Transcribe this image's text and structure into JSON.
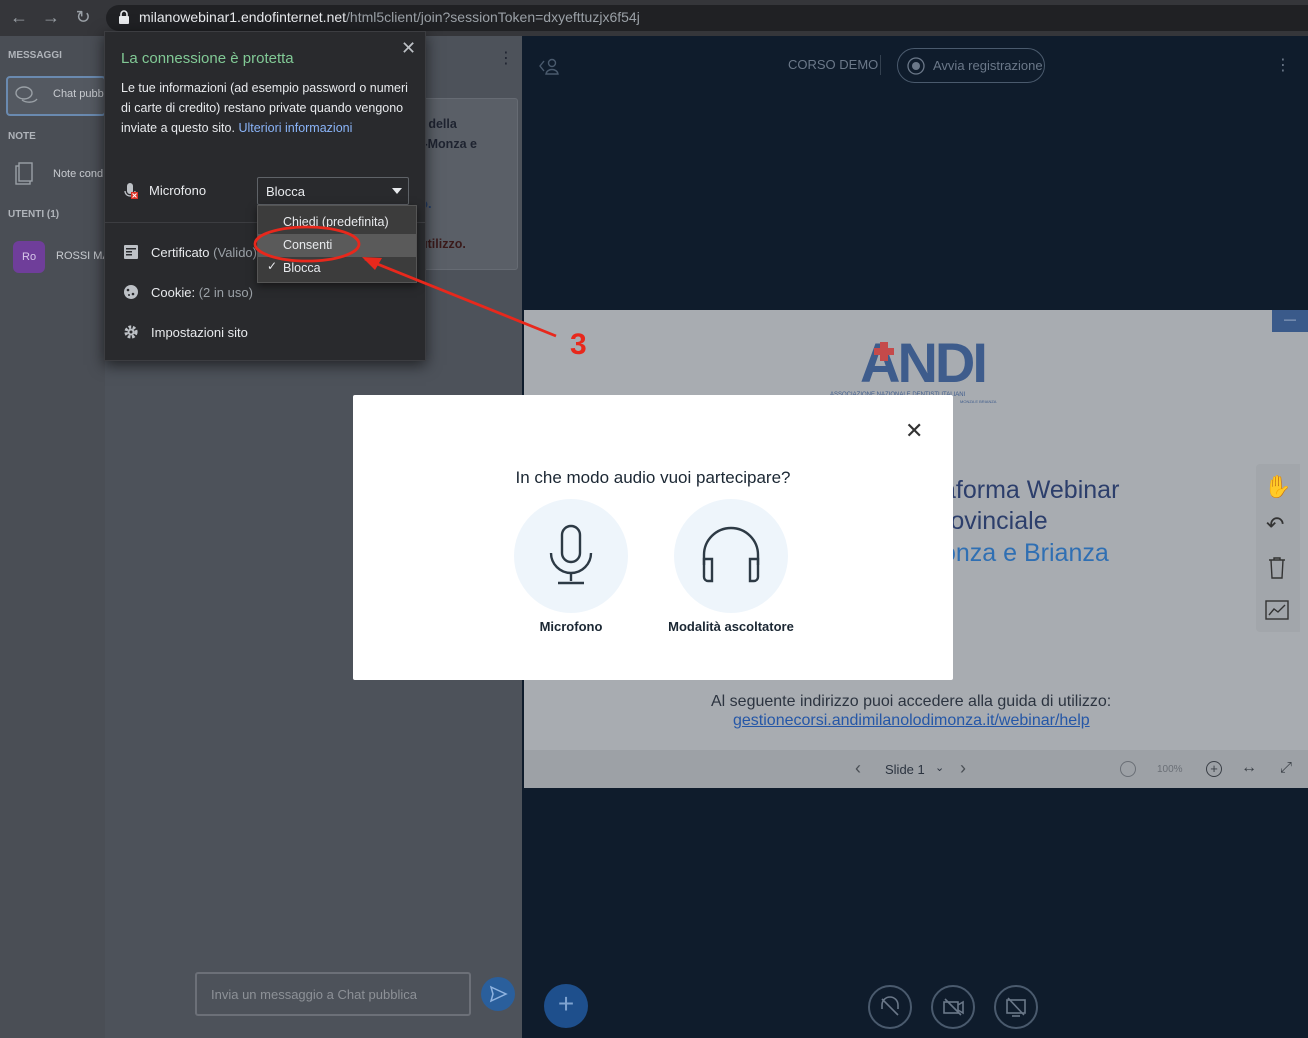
{
  "browser": {
    "url_host": "milanowebinar1.endofinternet.net",
    "url_path": "/html5client/join?sessionToken=dxyefttuzjx6f54j"
  },
  "sidebar": {
    "messages_header": "MESSAGGI",
    "public_chat": "Chat pubb",
    "notes_header": "NOTE",
    "shared_notes": "Note cond",
    "users_header": "UTENTI (1)",
    "user_avatar": "Ro",
    "user_name": "ROSSI MA"
  },
  "chat": {
    "welcome_line1": "r della",
    "welcome_line2": "i-Monza e",
    "welcome_line3": "o.",
    "welcome_line4": "utilizzo.",
    "input_placeholder": "Invia un messaggio a Chat pubblica"
  },
  "main": {
    "course_name": "CORSO DEMO",
    "record_label": "Avvia registrazione",
    "minimize_label": "—"
  },
  "slide": {
    "logo_text": "ANDI",
    "logo_sub1": "ASSOCIAZIONE NAZIONALE DENTISTI ITALIANI",
    "logo_sub2": "MONZA E BRIANZA",
    "line1": "aforma Webinar",
    "line2": "rovinciale",
    "line3": "onza e Brianza",
    "guide_text": "Al seguente indirizzo puoi accedere alla guida di utilizzo:",
    "guide_link": "gestionecorsi.andimilanolodimonza.it/webinar/help",
    "slide_label": "Slide 1",
    "zoom": "100%"
  },
  "modal": {
    "title": "In che modo audio vuoi partecipare?",
    "option_mic": "Microfono",
    "option_listen": "Modalità ascoltatore"
  },
  "popup": {
    "title": "La connessione è protetta",
    "desc": "Le tue informazioni (ad esempio password o numeri di carte di credito) restano private quando vengono inviate a questo sito.",
    "more_link": "Ulteriori informazioni",
    "mic_label": "Microfono",
    "mic_value": "Blocca",
    "dropdown_options": [
      "Chiedi (predefinita)",
      "Consenti",
      "Blocca"
    ],
    "cert_label": "Certificato",
    "cert_status": "(Valido)",
    "cookie_label": "Cookie:",
    "cookie_count": "(2 in uso)",
    "site_settings": "Impostazioni sito"
  },
  "annotation": {
    "step_number": "3",
    "color": "#e8281c"
  }
}
